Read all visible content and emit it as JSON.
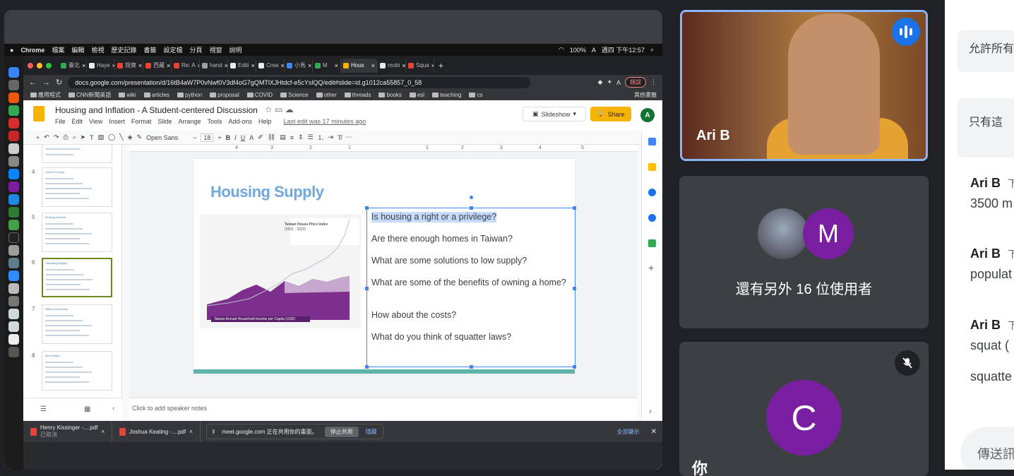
{
  "mac_menubar": {
    "app": "Chrome",
    "menus": [
      "檔案",
      "編輯",
      "檢視",
      "歷史記錄",
      "書籤",
      "設定檔",
      "分頁",
      "視窗",
      "說明"
    ],
    "battery": "100%",
    "input_source": "A",
    "clock": "週四 下午12:57"
  },
  "browser": {
    "tabs": [
      {
        "label": "臺北",
        "color": "#34a853"
      },
      {
        "label": "Haye",
        "color": "#e8eaed"
      },
      {
        "label": "观察",
        "color": "#ea4335"
      },
      {
        "label": "西藏",
        "color": "#ea4335"
      },
      {
        "label": "Re: A",
        "color": "#ea4335"
      },
      {
        "label": "hand",
        "color": "#9aa0a6"
      },
      {
        "label": "Editi",
        "color": "#e8eaed"
      },
      {
        "label": "Crea",
        "color": "#e8eaed"
      },
      {
        "label": "小馬",
        "color": "#4285f4"
      },
      {
        "label": "M",
        "color": "#34a853"
      },
      {
        "label": "Hous",
        "color": "#f4b400",
        "active": true
      },
      {
        "label": "mobi",
        "color": "#e8eaed"
      },
      {
        "label": "Squa",
        "color": "#ea4335"
      }
    ],
    "url": "docs.google.com/presentation/d/16tB4aW7P0vNwf0V3df4oG7gQMTlXJHtdcf-e5cYslQQ/edit#slide=id.g1012ca55857_0_58",
    "profile_initial": "A",
    "error_pill": "錯誤",
    "bookmarks": [
      "應用程式",
      "CNN新聞英語",
      "wiki",
      "articles",
      "python",
      "proposal",
      "COVID",
      "Science",
      "other",
      "threads",
      "books",
      "esl",
      "teaching",
      "cs"
    ],
    "other_bookmarks": "其他書籤"
  },
  "slides_app": {
    "doc_title": "Housing and Inflation - A Student-centered Discussion",
    "menus": [
      "File",
      "Edit",
      "View",
      "Insert",
      "Format",
      "Slide",
      "Arrange",
      "Tools",
      "Add-ons",
      "Help"
    ],
    "last_edit": "Last edit was 17 minutes ago",
    "slideshow_label": "Slideshow",
    "share_label": "Share",
    "user_initial": "A",
    "font_name": "Open Sans",
    "font_size": "18",
    "ruler_marks": [
      "4",
      "3",
      "2",
      "1",
      "1",
      "2",
      "3",
      "4",
      "5"
    ],
    "thumbnails": [
      {
        "num": "4",
        "title": "Cost of Living"
      },
      {
        "num": "5",
        "title": "Finding Homes"
      },
      {
        "num": "6",
        "title": "Housing Supply",
        "selected": true
      },
      {
        "num": "7",
        "title": "SRDs (Overview)"
      },
      {
        "num": "8",
        "title": "Next Steps"
      }
    ],
    "slide": {
      "title": "Housing Supply",
      "chart_top_label": "Taiwan House Price Index",
      "chart_top_sub": "(2001 - 2022)",
      "chart_bottom_label": "Taiwan Annual Household Income per Capita (USD)",
      "questions": [
        "Is housing a right or a privilege?",
        "Are there enough homes in Taiwan?",
        "What are some solutions to low supply?",
        "What are some of the benefits of owning a home?",
        "How about the costs?",
        "What do you think of squatter laws?"
      ]
    },
    "speaker_notes": "Click to add speaker notes"
  },
  "downloads": [
    {
      "name": "Henry Kissinger -....pdf",
      "status": "已取消"
    },
    {
      "name": "Joshua Keating -....pdf",
      "status": ""
    }
  ],
  "share_bar": {
    "text": "meet.google.com 正在共用你的畫面。",
    "stop": "停止共用",
    "hide": "隱藏"
  },
  "show_all": "全部顯示",
  "meet": {
    "tile1_name": "Ari B",
    "tile2_avatar_letter": "M",
    "others_text": "還有另外 16 位使用者",
    "tile3_avatar_letter": "C",
    "tile3_name": "你"
  },
  "chat": {
    "sys1": "允許所有",
    "sys2": "只有這",
    "messages": [
      {
        "sender": "Ari B",
        "time": "下",
        "text": "3500 m"
      },
      {
        "sender": "Ari B",
        "time": "下",
        "text": "populat"
      },
      {
        "sender": "Ari B",
        "time": "下",
        "text": "squat ("
      },
      {
        "sender": "",
        "time": "",
        "text": "squatte"
      }
    ],
    "input_placeholder": "傳送訊"
  }
}
